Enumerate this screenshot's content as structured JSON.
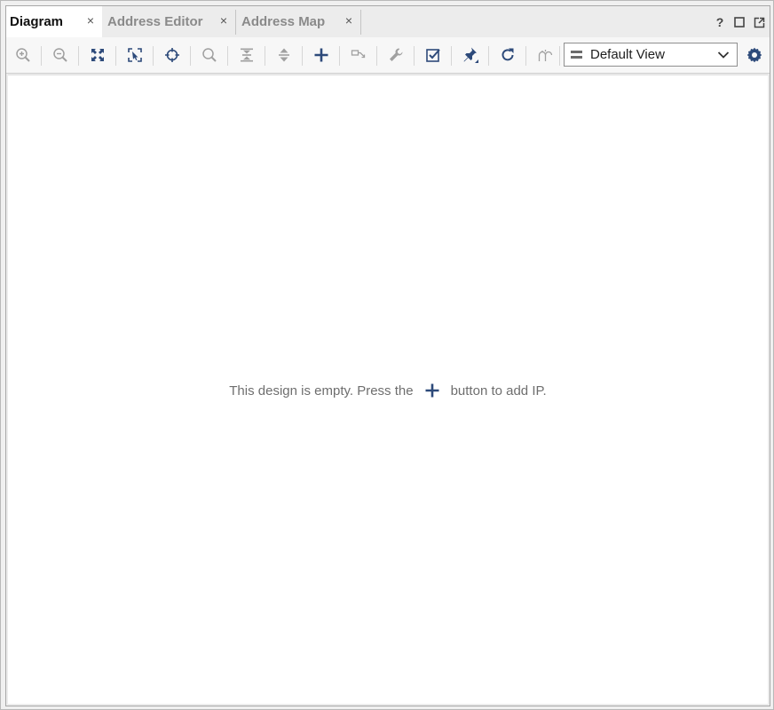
{
  "tabs": [
    {
      "label": "Diagram",
      "active": true
    },
    {
      "label": "Address Editor",
      "active": false
    },
    {
      "label": "Address Map",
      "active": false
    }
  ],
  "tab_close_glyph": "×",
  "window_controls": {
    "help": "?",
    "maximize_icon": "maximize-icon",
    "float_icon": "float-window-icon"
  },
  "toolbar": {
    "buttons": [
      "zoom-in-icon",
      "zoom-out-icon",
      "fit-full-screen-icon",
      "zoom-fit-selection-icon",
      "auto-fit-target-icon",
      "search-icon",
      "collapse-all-icon",
      "expand-all-icon",
      "add-ip-icon",
      "make-connection-icon",
      "customize-wrench-icon",
      "validate-design-icon",
      "pin-icon",
      "regenerate-layout-icon",
      "route-icon"
    ],
    "view_select": {
      "value": "Default View"
    },
    "settings_icon": "gear-icon"
  },
  "canvas": {
    "empty_before": "This design is empty. Press the",
    "empty_after": "button to add IP."
  },
  "colors": {
    "accent": "#2d4a7a",
    "icon_disabled": "#a0a0a0",
    "tab_active_bg": "#ffffff",
    "tab_inactive_text": "#8a8a8a"
  }
}
